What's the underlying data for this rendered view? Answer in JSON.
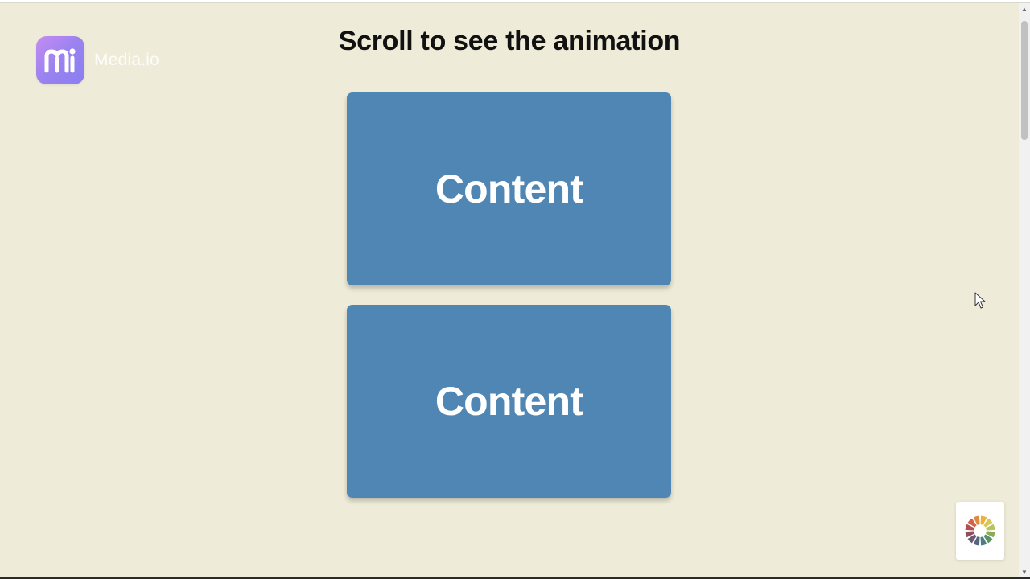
{
  "watermark": {
    "logo_icon": "media-io-logo-icon",
    "brand_text": "Media.io",
    "logo_colors": [
      "#c48cf2",
      "#8a7ef2"
    ]
  },
  "page": {
    "title": "Scroll to see the animation",
    "background_color": "#eeecd8"
  },
  "cards": [
    {
      "label": "Content",
      "color": "#5086b3"
    },
    {
      "label": "Content",
      "color": "#5086b3"
    }
  ],
  "scrollbar": {
    "up_icon": "scroll-up-arrow-icon",
    "down_icon": "scroll-down-arrow-icon"
  },
  "widgets": {
    "color_wheel_icon": "color-wheel-icon"
  },
  "cursor_icon": "mouse-pointer-icon"
}
